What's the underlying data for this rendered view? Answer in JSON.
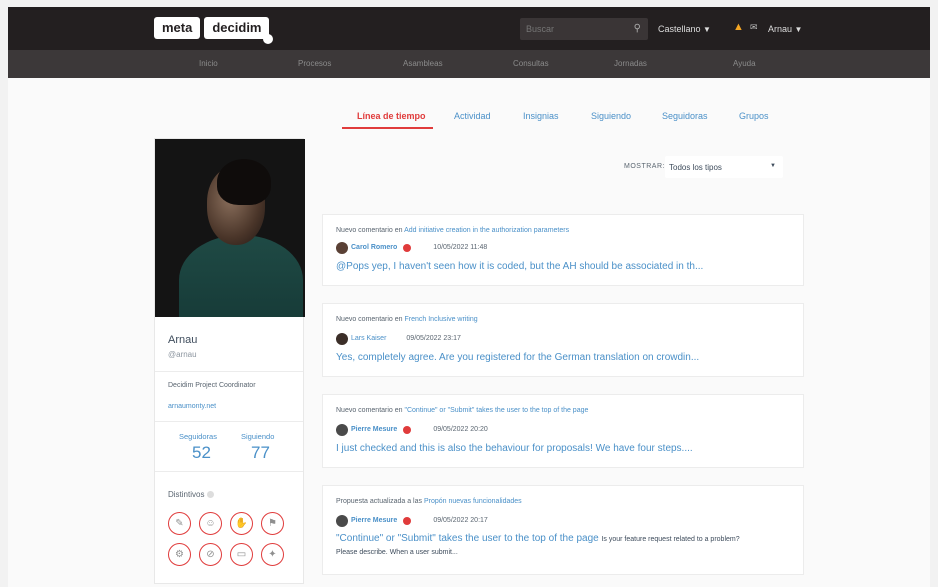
{
  "header": {
    "logo_left": "meta",
    "logo_right": "decidim",
    "search_placeholder": "Buscar",
    "language": "Castellano",
    "user": "Arnau"
  },
  "nav": [
    "Inicio",
    "Procesos",
    "Asambleas",
    "Consultas",
    "Jornadas",
    "Ayuda"
  ],
  "tabs": [
    "Línea de tiempo",
    "Actividad",
    "Insignias",
    "Siguiendo",
    "Seguidoras",
    "Grupos"
  ],
  "profile": {
    "name": "Arnau",
    "handle": "@arnau",
    "role": "Decidim Project Coordinator",
    "website": "arnaumonty.net",
    "followers_label": "Seguidoras",
    "followers": "52",
    "following_label": "Siguiendo",
    "following": "77",
    "badges_title": "Distintivos"
  },
  "filter": {
    "label": "MOSTRAR:",
    "value": "Todos los tipos"
  },
  "timeline": [
    {
      "action": "Nuevo comentario en",
      "target": "Add initiative creation in the authorization parameters",
      "author": "Carol Romero",
      "date": "10/05/2022 11:48",
      "text": "@Pops yep, I haven't seen how it is coded, but the AH should be associated in th..."
    },
    {
      "action": "Nuevo comentario en",
      "target": "French Inclusive writing",
      "author": "Lars Kaiser",
      "date": "09/05/2022 23:17",
      "text": "Yes, completely agree. Are you registered for the German translation on crowdin..."
    },
    {
      "action": "Nuevo comentario en",
      "target": "\"Continue\" or \"Submit\" takes the user to the top of the page",
      "author": "Pierre Mesure",
      "date": "09/05/2022 20:20",
      "text": "I just checked and this is also the behaviour for proposals! We have four steps...."
    },
    {
      "action": "Propuesta actualizada a las",
      "target": "Propón nuevas funcionalidades",
      "author": "Pierre Mesure",
      "date": "09/05/2022 20:17",
      "text": "\"Continue\" or \"Submit\" takes the user to the top of the page",
      "extra": "Is your feature request related to a problem?",
      "extra2": "Please describe. When a user submit..."
    }
  ],
  "colors": {
    "accent": "#e03b3b",
    "link": "#4a90c8",
    "topbar": "#231f20",
    "navbar": "#3c3839"
  }
}
